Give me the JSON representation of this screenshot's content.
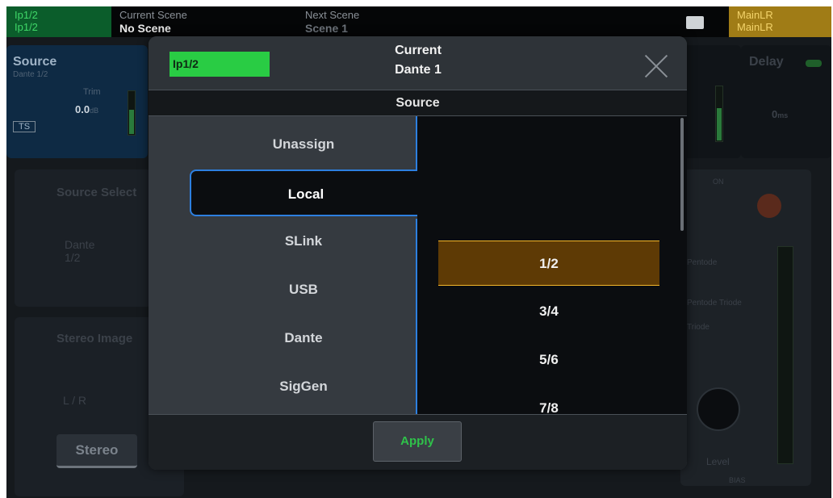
{
  "topbar": {
    "channel_line1": "Ip1/2",
    "channel_line2": "Ip1/2",
    "current_scene_label": "Current Scene",
    "current_scene_value": "No Scene",
    "next_scene_label": "Next Scene",
    "next_scene_value": "Scene 1",
    "sd_icon": "sd-card-icon",
    "main_line1": "MainLR",
    "main_line2": "MainLR"
  },
  "background": {
    "source_title": "Source",
    "source_subtitle": "Dante 1/2",
    "trim_label": "Trim",
    "trim_value": "0.0",
    "trim_unit": "dB",
    "ts_badge": "TS",
    "source_select_label": "Source Select",
    "dante_tile": "Dante 1/2",
    "stereo_image_label": "Stereo Image",
    "lr_select": "L / R",
    "stereo_button": "Stereo",
    "delay_label": "Delay",
    "delay_value": "0",
    "delay_unit": "ms",
    "on_label": "ON",
    "pentode": "Pentode",
    "triode": "Triode",
    "pentode_triode": "Pentode Triode",
    "level_label": "Level",
    "bias_label": "BIAS",
    "colors": {
      "channel_green": "#0b5d2b",
      "main_gold": "#a07c16",
      "source_tile": "#0e2a44"
    }
  },
  "modal": {
    "channel_chip": "Ip1/2",
    "current_label": "Current",
    "current_value": "Dante 1",
    "close_icon": "close-icon",
    "section_title": "Source",
    "tabs": [
      "Unassign",
      "Local",
      "SLink",
      "USB",
      "Dante",
      "SigGen"
    ],
    "active_tab": "Local",
    "options": [
      "1/2",
      "3/4",
      "5/6",
      "7/8"
    ],
    "selected_option": "1/2",
    "apply_label": "Apply",
    "colors": {
      "chip": "#29cc44",
      "accent_blue": "#2d7fe0",
      "selected_bg": "#5e3a05",
      "selected_border": "#f3b72a",
      "apply_text": "#2fc24a"
    }
  }
}
